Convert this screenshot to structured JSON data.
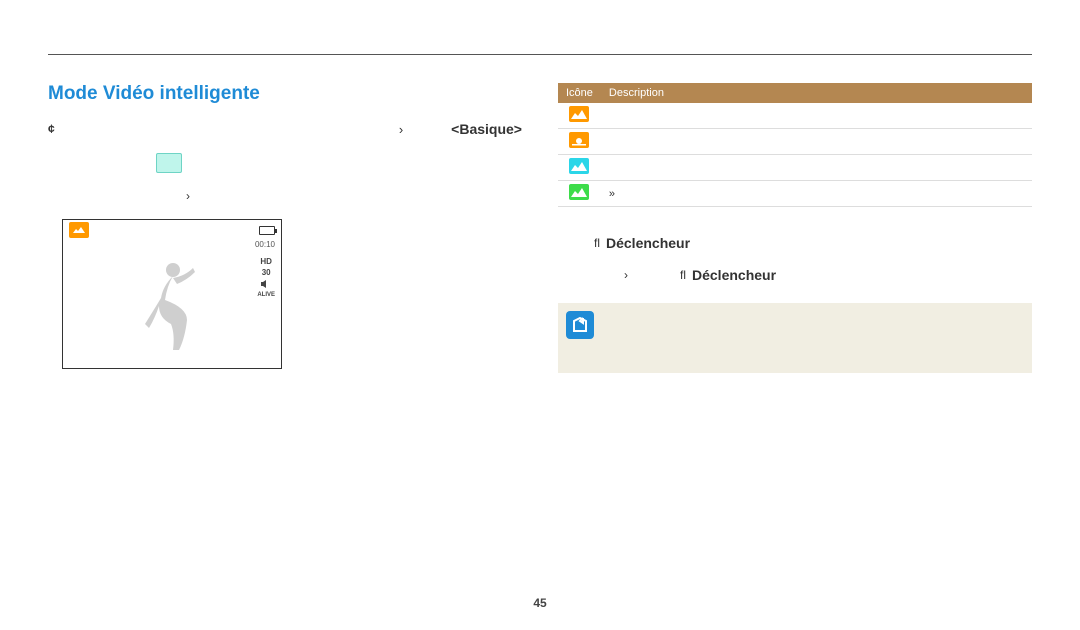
{
  "page_number": "45",
  "left": {
    "title": "Mode Vidéo intelligente",
    "step1_prefix_symbol": "¢",
    "step1_arrow": "›",
    "step1_category": "<Basique>",
    "step2_arrow": "›"
  },
  "viewfinder": {
    "face_label": "",
    "timer": "00:10",
    "hd_label": "HD",
    "fps_label": "30",
    "alive_label": "ALIVE"
  },
  "table": {
    "headers": {
      "icon": "Icône",
      "desc": "Description"
    },
    "rows": [
      {
        "icon_name": "landscape-icon",
        "icon_class": "b-orange",
        "desc": ""
      },
      {
        "icon_name": "sunset-icon",
        "icon_class": "b-orange2",
        "desc": ""
      },
      {
        "icon_name": "sky-icon",
        "icon_class": "b-cyan",
        "desc": ""
      },
      {
        "icon_name": "forest-icon",
        "icon_class": "b-green",
        "desc": "»"
      }
    ]
  },
  "right": {
    "step3_prefix": "ﬂ",
    "step3_label": "Déclencheur",
    "step4_arrow": "›",
    "step4_prefix": "ﬂ",
    "step4_label": "Déclencheur"
  }
}
